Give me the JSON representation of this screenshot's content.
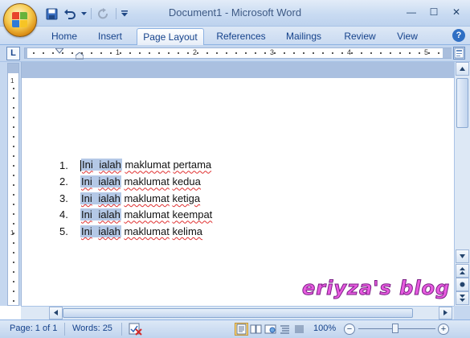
{
  "window": {
    "title": "Document1 - Microsoft Word",
    "minimize_glyph": "—",
    "maximize_glyph": "☐",
    "close_glyph": "✕"
  },
  "quick_access": {
    "save_icon": "save-icon",
    "undo_icon": "undo-icon",
    "redo_icon": "redo-icon",
    "customize_icon": "customize-arrow-icon"
  },
  "ribbon": {
    "tabs": [
      {
        "label": "Home"
      },
      {
        "label": "Insert"
      },
      {
        "label": "Page Layout",
        "active": true
      },
      {
        "label": "References"
      },
      {
        "label": "Mailings"
      },
      {
        "label": "Review"
      },
      {
        "label": "View"
      }
    ],
    "help_label": "?"
  },
  "ruler": {
    "tab_selector_label": "L",
    "numbers": [
      "1",
      "2",
      "3",
      "4",
      "5"
    ],
    "vertical_numbers": [
      "1",
      "1"
    ]
  },
  "document": {
    "list_items": [
      {
        "number": "1.",
        "words": [
          "Ini",
          "ialah",
          "maklumat",
          "pertama"
        ]
      },
      {
        "number": "2.",
        "words": [
          "Ini",
          "ialah",
          "maklumat",
          "kedua"
        ]
      },
      {
        "number": "3.",
        "words": [
          "Ini",
          "ialah",
          "maklumat",
          "ketiga"
        ]
      },
      {
        "number": "4.",
        "words": [
          "Ini",
          "ialah",
          "maklumat",
          "keempat"
        ]
      },
      {
        "number": "5.",
        "words": [
          "Ini",
          "ialah",
          "maklumat",
          "kelima"
        ]
      }
    ],
    "watermark": "eriyza's blog"
  },
  "status_bar": {
    "page": "Page: 1 of 1",
    "words": "Words: 25",
    "zoom": "100%",
    "zoom_minus": "−",
    "zoom_plus": "+",
    "active_view": "print-layout"
  },
  "colors": {
    "ribbon_blue": "#c9daf1",
    "selection": "#b4c8e6",
    "spell_underline": "#e03030",
    "watermark": "#e85be0"
  }
}
